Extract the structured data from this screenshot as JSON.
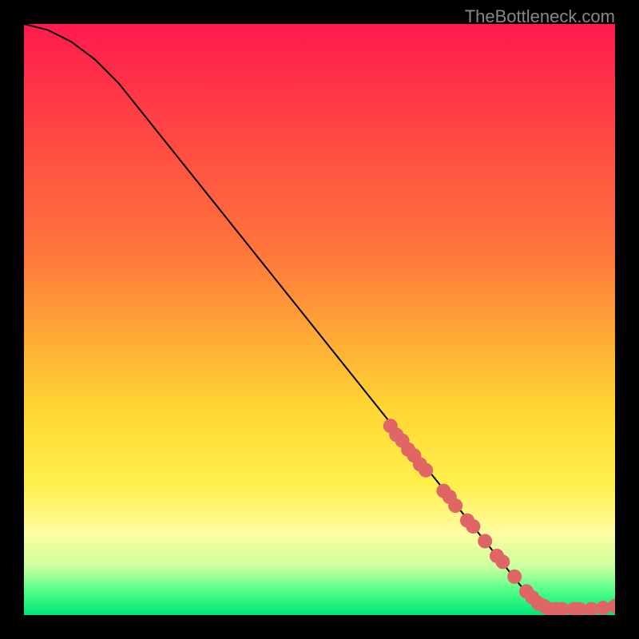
{
  "watermark": "TheBottleneck.com",
  "chart_data": {
    "type": "line",
    "title": "",
    "xlabel": "",
    "ylabel": "",
    "xlim": [
      0,
      100
    ],
    "ylim": [
      0,
      100
    ],
    "background_gradient": {
      "stops": [
        {
          "offset": 0,
          "color": "#ff1a4d"
        },
        {
          "offset": 40,
          "color": "#ff7a3a"
        },
        {
          "offset": 65,
          "color": "#ffd633"
        },
        {
          "offset": 78,
          "color": "#fff04d"
        },
        {
          "offset": 86,
          "color": "#fffca0"
        },
        {
          "offset": 92,
          "color": "#c8ff9e"
        },
        {
          "offset": 96,
          "color": "#4dff88"
        },
        {
          "offset": 100,
          "color": "#00e673"
        }
      ]
    },
    "curve": [
      {
        "x": 0,
        "y": 100
      },
      {
        "x": 4,
        "y": 99
      },
      {
        "x": 8,
        "y": 97
      },
      {
        "x": 12,
        "y": 94
      },
      {
        "x": 16,
        "y": 90
      },
      {
        "x": 20,
        "y": 85
      },
      {
        "x": 30,
        "y": 72.5
      },
      {
        "x": 40,
        "y": 60
      },
      {
        "x": 50,
        "y": 47.5
      },
      {
        "x": 60,
        "y": 35
      },
      {
        "x": 70,
        "y": 22.5
      },
      {
        "x": 78,
        "y": 12.5
      },
      {
        "x": 84,
        "y": 5
      },
      {
        "x": 87,
        "y": 2
      },
      {
        "x": 90,
        "y": 1
      },
      {
        "x": 95,
        "y": 1
      },
      {
        "x": 100,
        "y": 1.5
      }
    ],
    "markers": [
      {
        "x": 62,
        "y": 32
      },
      {
        "x": 63,
        "y": 30.5
      },
      {
        "x": 64,
        "y": 29.5
      },
      {
        "x": 65,
        "y": 28
      },
      {
        "x": 66,
        "y": 27
      },
      {
        "x": 67,
        "y": 25.5
      },
      {
        "x": 68,
        "y": 24.5
      },
      {
        "x": 71,
        "y": 21
      },
      {
        "x": 72,
        "y": 20
      },
      {
        "x": 73,
        "y": 18.5
      },
      {
        "x": 75,
        "y": 16
      },
      {
        "x": 76,
        "y": 15
      },
      {
        "x": 78,
        "y": 12.5
      },
      {
        "x": 80,
        "y": 10
      },
      {
        "x": 81,
        "y": 9
      },
      {
        "x": 83,
        "y": 6.5
      },
      {
        "x": 85,
        "y": 4
      },
      {
        "x": 86,
        "y": 3
      },
      {
        "x": 87,
        "y": 2
      },
      {
        "x": 88,
        "y": 1.5
      },
      {
        "x": 89,
        "y": 1
      },
      {
        "x": 90,
        "y": 1
      },
      {
        "x": 91,
        "y": 1
      },
      {
        "x": 93,
        "y": 1
      },
      {
        "x": 94,
        "y": 1
      },
      {
        "x": 96,
        "y": 1
      },
      {
        "x": 98,
        "y": 1.2
      },
      {
        "x": 100,
        "y": 1.5
      }
    ],
    "marker_color": "#e06666",
    "line_color": "#000000"
  }
}
